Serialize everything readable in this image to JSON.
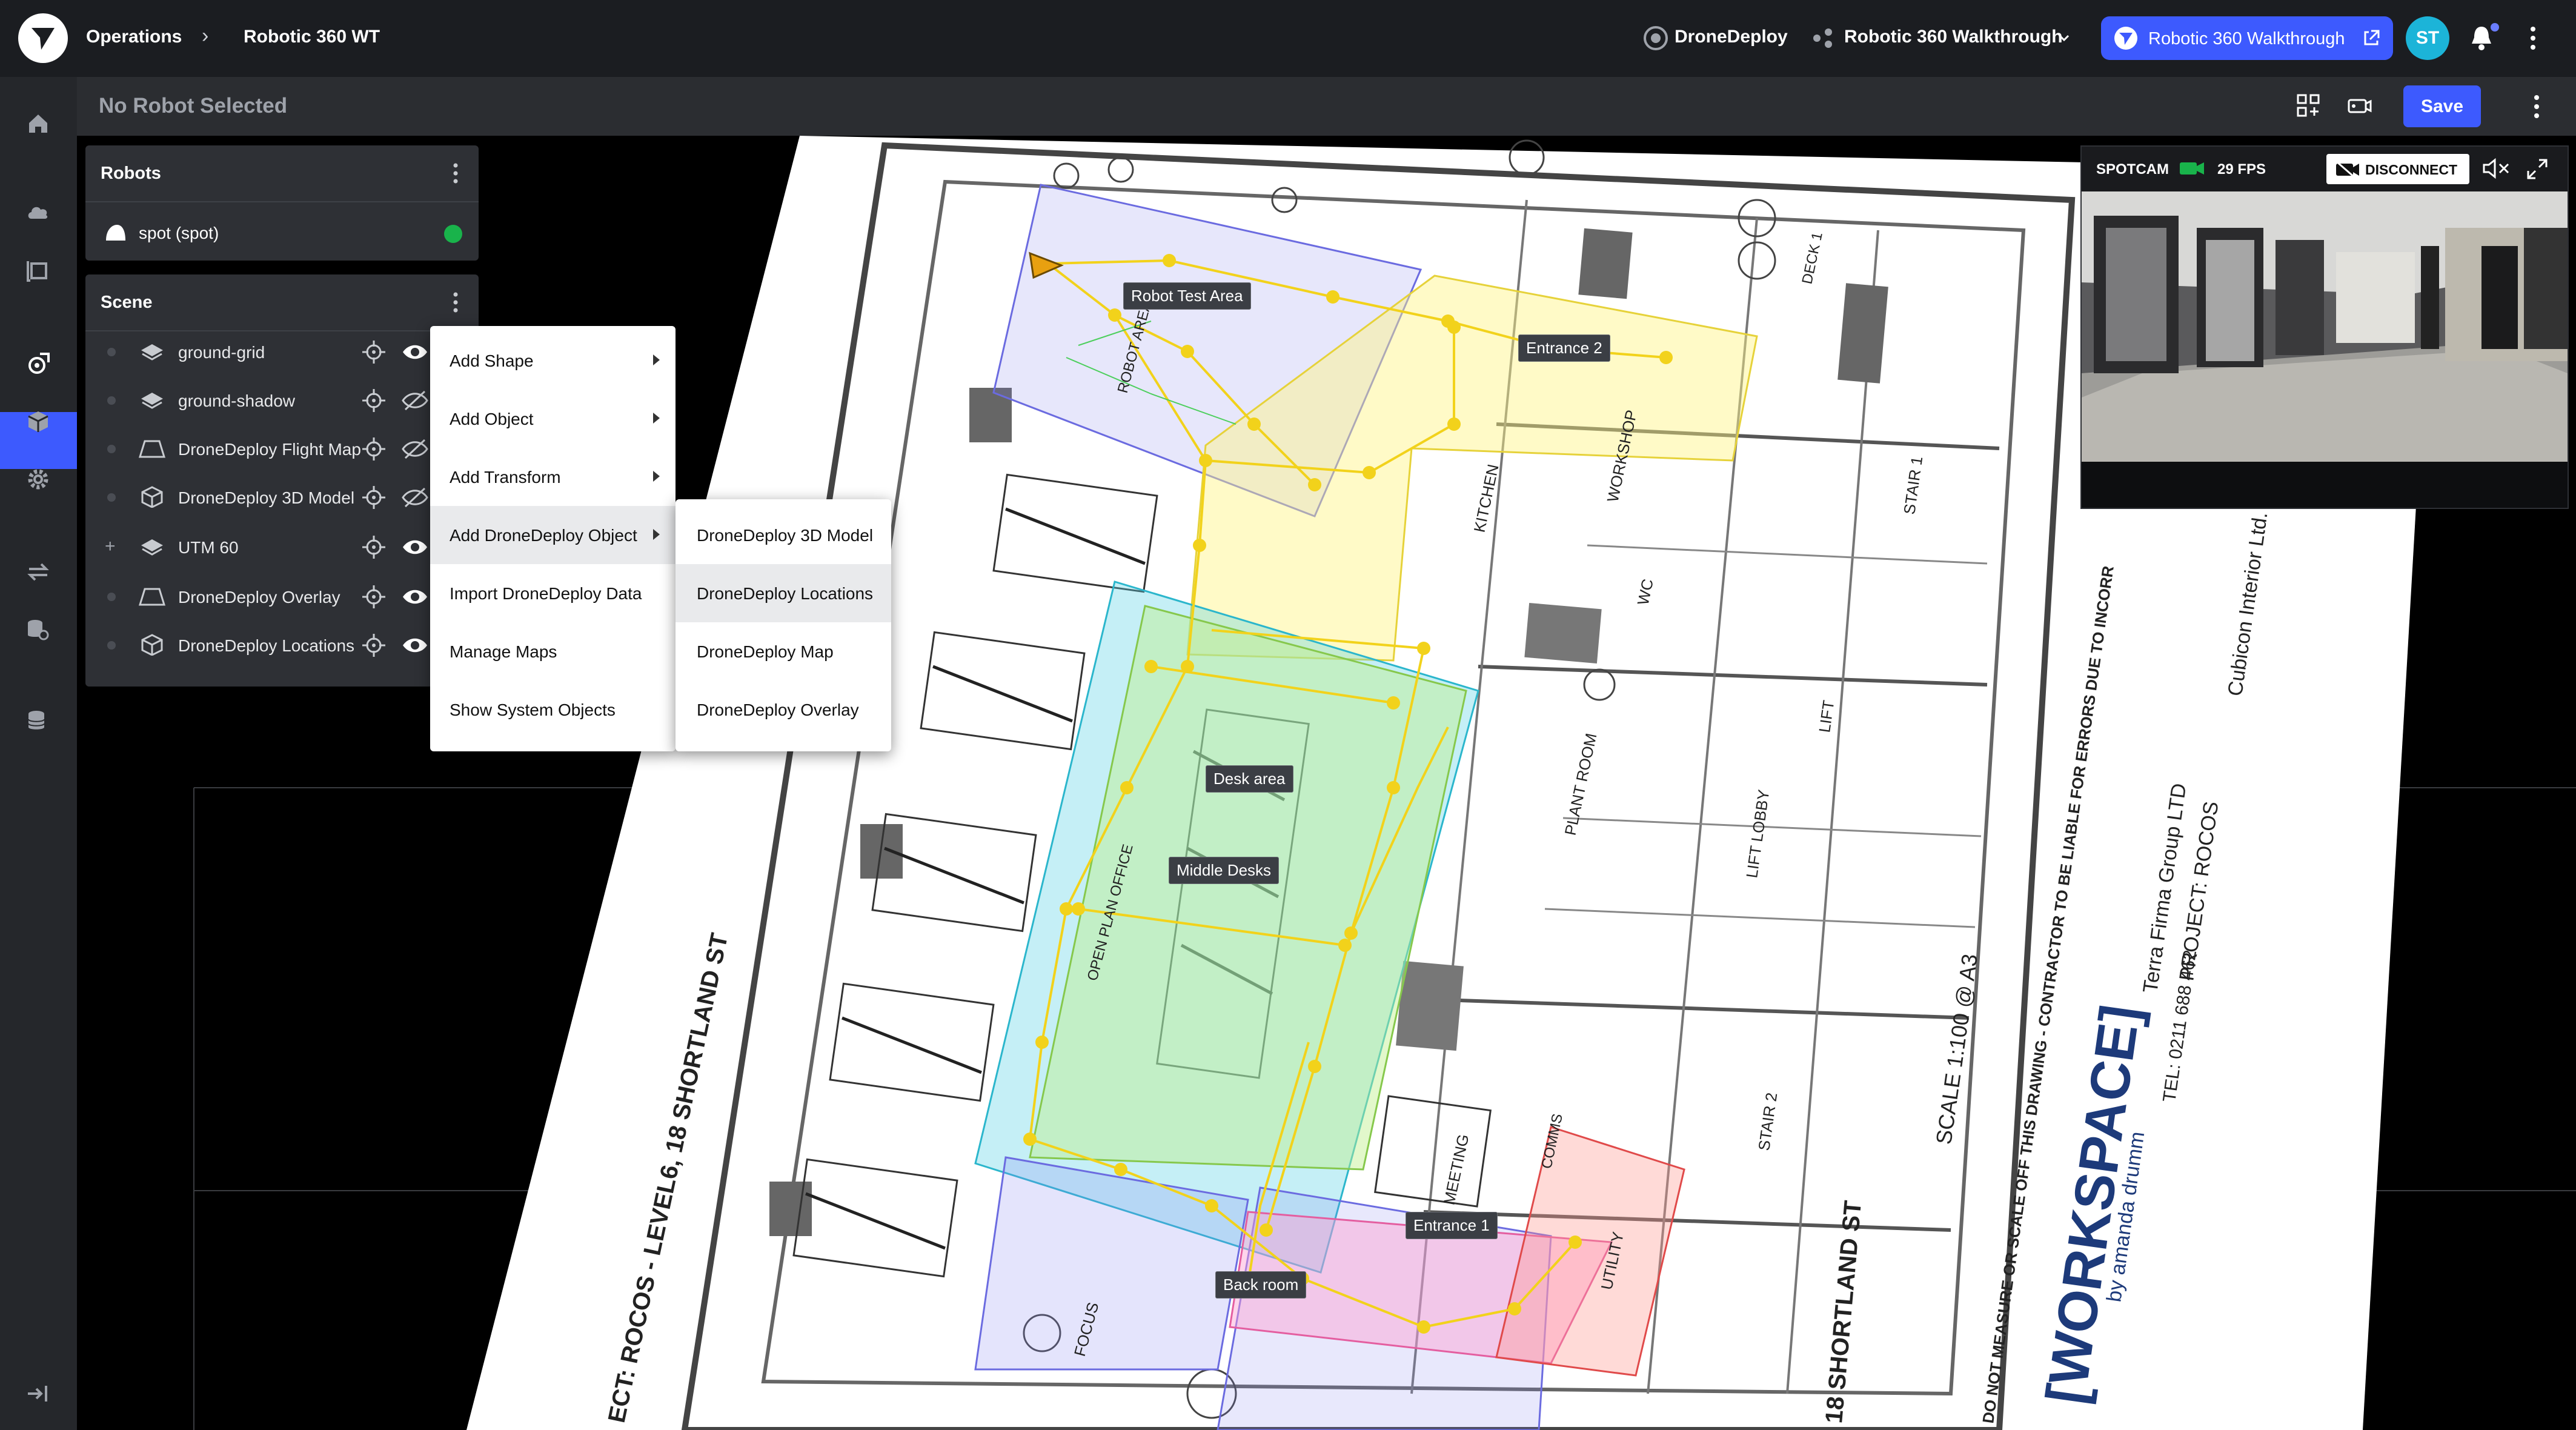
{
  "topbar": {
    "breadcrumb": [
      "Operations",
      "Robotic 360 WT"
    ],
    "brand": "DroneDeploy",
    "project_select": "Robotic 360 Walkthrough",
    "project_link": "Robotic 360 Walkthrough",
    "avatar_initials": "ST",
    "accent_color": "#3d5afe"
  },
  "subheader": {
    "robot_status": "No Robot Selected",
    "save_label": "Save"
  },
  "robots_panel": {
    "title": "Robots",
    "robots": [
      {
        "name": "spot (spot)",
        "status_color": "#19b34b"
      }
    ]
  },
  "scene_panel": {
    "title": "Scene",
    "items": [
      {
        "label": "ground-grid",
        "icon": "layers-icon",
        "visible": true
      },
      {
        "label": "ground-shadow",
        "icon": "layers-icon",
        "visible": false
      },
      {
        "label": "DroneDeploy Flight Map",
        "icon": "map-plane-icon",
        "visible": false
      },
      {
        "label": "DroneDeploy 3D Model",
        "icon": "cube-icon",
        "visible": false
      },
      {
        "label": "UTM 60",
        "icon": "layers-icon",
        "visible": true
      },
      {
        "label": "DroneDeploy Overlay",
        "icon": "map-plane-icon",
        "visible": true
      },
      {
        "label": "DroneDeploy Locations",
        "icon": "cube-icon",
        "visible": true
      }
    ]
  },
  "context_menu": {
    "items": [
      "Add Shape",
      "Add Object",
      "Add Transform",
      "Add DroneDeploy Object",
      "Import DroneDeploy Data",
      "Manage Maps",
      "Show System Objects"
    ],
    "submenu": [
      "DroneDeploy 3D Model",
      "DroneDeploy Locations",
      "DroneDeploy Map",
      "DroneDeploy Overlay"
    ]
  },
  "camera": {
    "title": "SPOTCAM",
    "fps": "29 FPS",
    "disconnect_label": "DISCONNECT"
  },
  "zones": [
    "Robot Test Area",
    "Entrance 2",
    "Desk area",
    "Middle Desks",
    "Entrance 1",
    "Back room"
  ],
  "plan_text": {
    "street_left": "ECT: ROCOS - LEVEL6, 18 SHORTLAND ST",
    "street_right": "18 SHORTLAND ST",
    "scale": "SCALE 1:100 @ A3",
    "disclaimer": "DO NOT MEASURE OR SCALE OFF THIS DRAWING - CONTRACTOR TO BE LIABLE FOR ERRORS DUE TO INCORR",
    "brand": "[WORKSPACE]",
    "brand_sub": "by amanda drumm",
    "contractor": "Cubicon Interior Ltd.",
    "project": "PROJECT: ROCOS",
    "client": "Terra Firma Group LTD",
    "tel": "TEL: 0211 688 462",
    "rooms": [
      "ROBOT AREA",
      "KITCHEN",
      "WORKSHOP",
      "WC",
      "PLANT ROOM",
      "LIFT LOBBY",
      "LIFT",
      "STAIR 1",
      "STAIR 2",
      "MEETING",
      "COMMS",
      "UTILITY",
      "FOCUS",
      "DECK 1",
      "OPEN PLAN OFFICE"
    ]
  }
}
